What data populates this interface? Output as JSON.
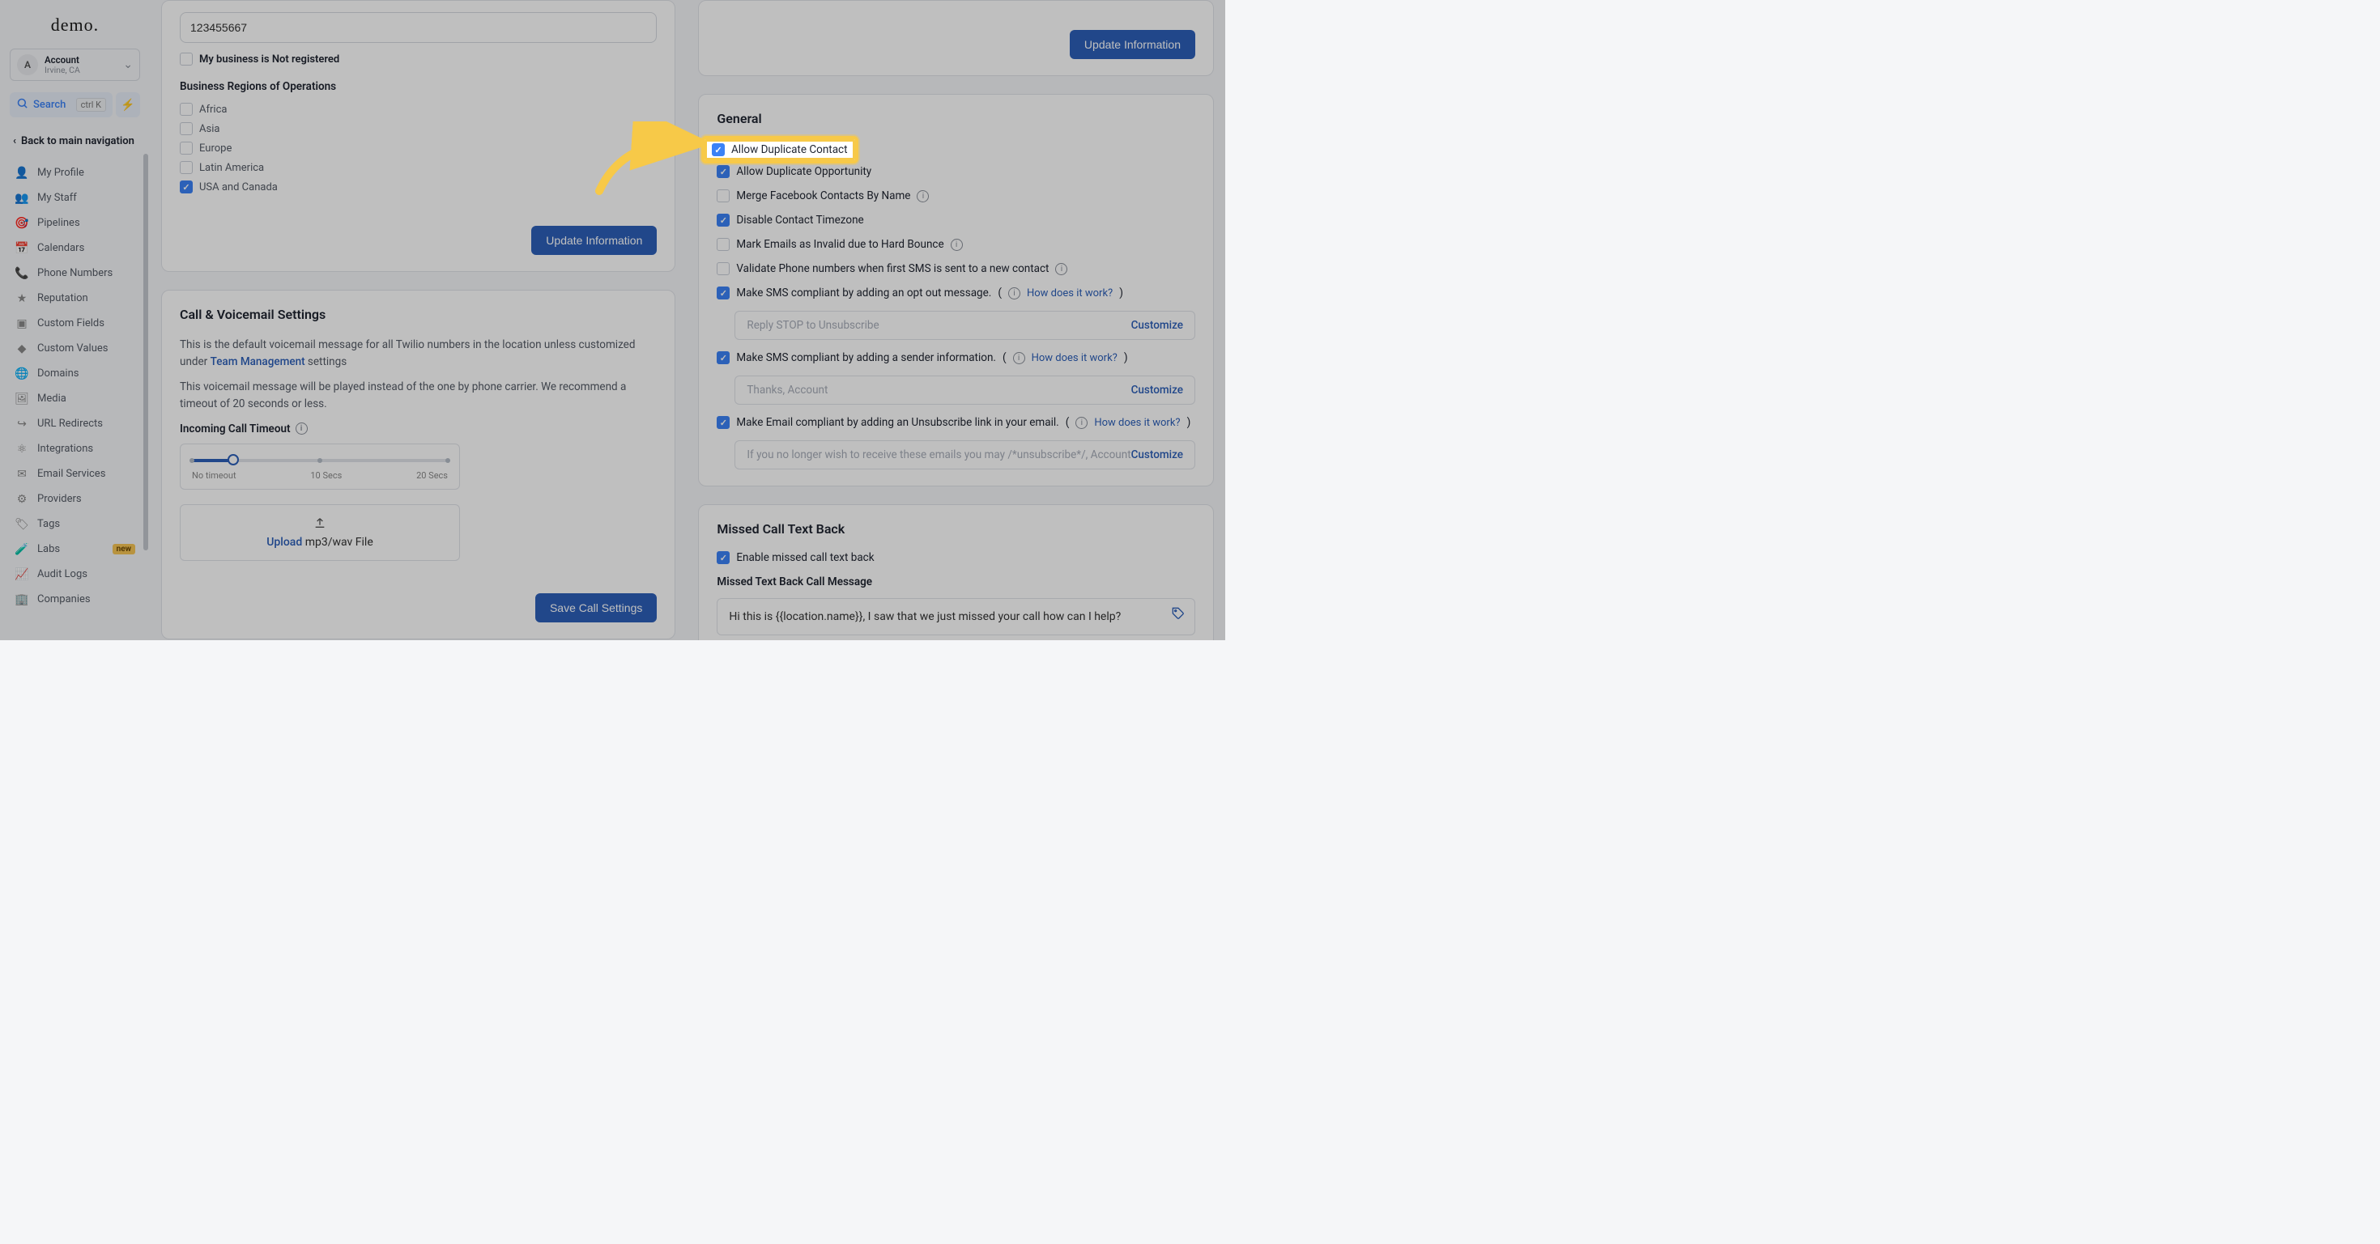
{
  "brand": {
    "logo": "demo."
  },
  "account": {
    "initial": "A",
    "title": "Account",
    "sub": "Irvine, CA"
  },
  "search": {
    "label": "Search",
    "kbd": "ctrl K"
  },
  "backNav": "Back to main navigation",
  "sidebarItems": [
    {
      "icon": "👤",
      "label": "My Profile"
    },
    {
      "icon": "👥",
      "label": "My Staff"
    },
    {
      "icon": "📊",
      "label": "Pipelines"
    },
    {
      "icon": "📅",
      "label": "Calendars"
    },
    {
      "icon": "📞",
      "label": "Phone Numbers"
    },
    {
      "icon": "★",
      "label": "Reputation"
    },
    {
      "icon": "▣",
      "label": "Custom Fields"
    },
    {
      "icon": "◆",
      "label": "Custom Values"
    },
    {
      "icon": "🌐",
      "label": "Domains"
    },
    {
      "icon": "🖼",
      "label": "Media"
    },
    {
      "icon": "↪",
      "label": "URL Redirects"
    },
    {
      "icon": "⚛",
      "label": "Integrations"
    },
    {
      "icon": "✉",
      "label": "Email Services"
    },
    {
      "icon": "⚙",
      "label": "Providers"
    },
    {
      "icon": "🏷",
      "label": "Tags"
    },
    {
      "icon": "🧪",
      "label": "Labs",
      "badge": "new"
    },
    {
      "icon": "📈",
      "label": "Audit Logs"
    },
    {
      "icon": "🏢",
      "label": "Companies"
    }
  ],
  "bizSection": {
    "numberValue": "123455667",
    "notRegistered": "My business is Not registered",
    "regionsLabel": "Business Regions of Operations",
    "regions": {
      "africa": "Africa",
      "asia": "Asia",
      "europe": "Europe",
      "latam": "Latin America",
      "usca": "USA and Canada"
    },
    "updateBtn": "Update Information"
  },
  "voicemail": {
    "title": "Call & Voicemail Settings",
    "help1a": "This is the default voicemail message for all Twilio numbers in the location unless customized under ",
    "help1Link": "Team Management",
    "help1b": " settings",
    "help2": "This voicemail message will be played instead of the one by phone carrier. We recommend a timeout of 20 seconds or less.",
    "timeoutLabel": "Incoming Call Timeout",
    "sliderLabels": {
      "left": "No timeout",
      "mid": "10 Secs",
      "right": "20 Secs"
    },
    "uploadLink": "Upload",
    "uploadText": " mp3/wav File",
    "saveBtn": "Save Call Settings"
  },
  "rightTop": {
    "updateBtn": "Update Information"
  },
  "general": {
    "title": "General",
    "allowDupContact": "Allow Duplicate Contact",
    "allowDupOpp": "Allow Duplicate Opportunity",
    "mergeFb": "Merge Facebook Contacts By Name",
    "disableTz": "Disable Contact Timezone",
    "hardBounce": "Mark Emails as Invalid due to Hard Bounce",
    "validatePhone": "Validate Phone numbers when first SMS is sent to a new contact",
    "smsOptOut": "Make SMS compliant by adding an opt out message.",
    "howWorks": "How does it work?",
    "replyStop": "Reply STOP to Unsubscribe",
    "customize": "Customize",
    "smsSender": "Make SMS compliant by adding a sender information.",
    "thanks": "Thanks, Account",
    "emailUnsub": "Make Email compliant by adding an Unsubscribe link in your email.",
    "emailUnsubText": "If you no longer wish to receive these emails you may /*unsubscribe*/, Account"
  },
  "missedCall": {
    "title": "Missed Call Text Back",
    "enable": "Enable missed call text back",
    "msgLabel": "Missed Text Back Call Message",
    "msgValue": "Hi this is {{location.name}}, I saw that we just missed your call how can I help?"
  }
}
